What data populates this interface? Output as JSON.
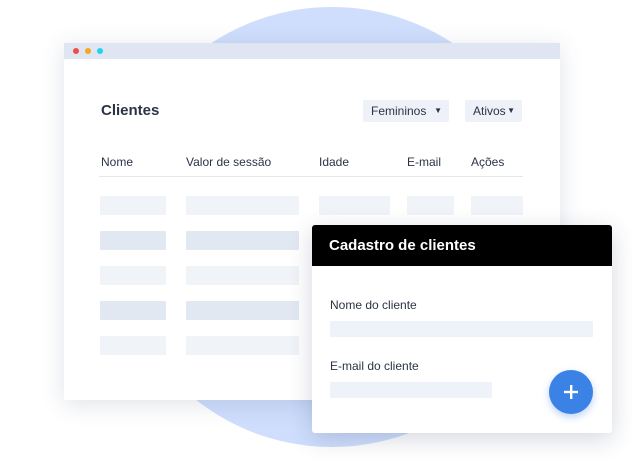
{
  "window": {
    "title": "Clientes",
    "filters": [
      {
        "label": "Femininos",
        "icon": "chevron-down-icon"
      },
      {
        "label": "Ativos",
        "icon": "chevron-down-icon"
      }
    ],
    "table": {
      "columns": [
        "Nome",
        "Valor de sessão",
        "Idade",
        "E-mail",
        "Ações"
      ],
      "placeholder_rows": 5
    }
  },
  "dialog": {
    "title": "Cadastro de clientes",
    "fields": [
      {
        "label": "Nome do cliente"
      },
      {
        "label": "E-mail do cliente"
      }
    ],
    "add_button_icon": "plus-icon"
  },
  "colors": {
    "background_circle": "#cfdefd",
    "placeholder_light": "#f0f3f8",
    "placeholder_dark": "#e2e8f2",
    "dialog_header": "#000000",
    "accent": "#3b82e6"
  }
}
